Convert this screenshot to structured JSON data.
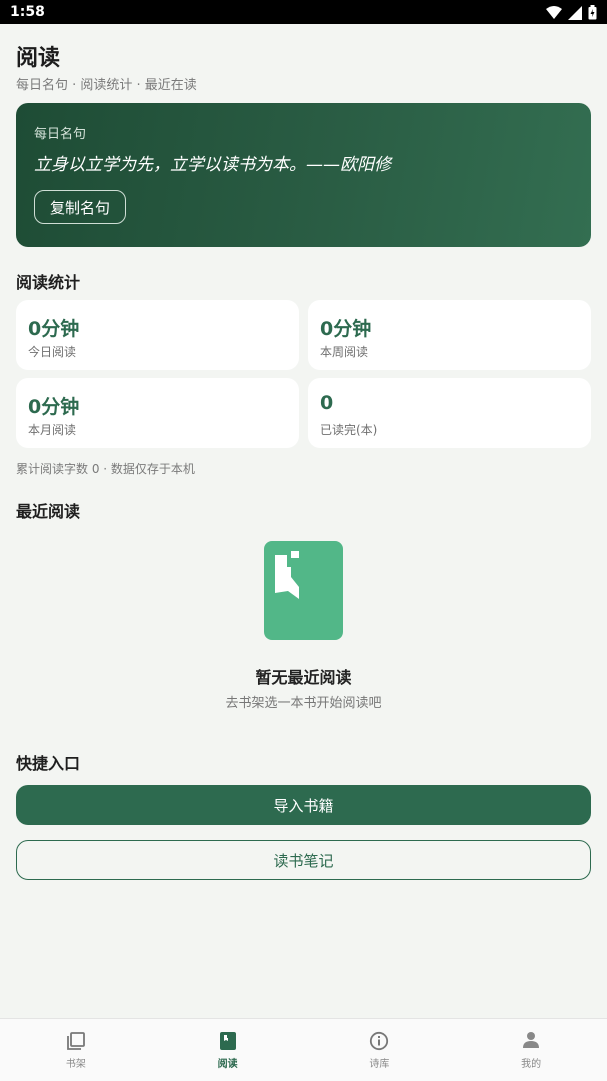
{
  "status_bar": {
    "time": "1:58"
  },
  "header": {
    "title": "阅读",
    "subtitle": "每日名句 · 阅读统计 · 最近在读"
  },
  "quote_card": {
    "label": "每日名句",
    "text": "立身以立学为先，立学以读书为本。——欧阳修",
    "copy_button": "复制名句"
  },
  "stats": {
    "title": "阅读统计",
    "cards": [
      {
        "value": "0分钟",
        "label": "今日阅读"
      },
      {
        "value": "0分钟",
        "label": "本周阅读"
      },
      {
        "value": "0分钟",
        "label": "本月阅读"
      },
      {
        "value": "0",
        "label": "已读完(本)"
      }
    ],
    "note": "累计阅读字数 0 · 数据仅存于本机"
  },
  "recent": {
    "title": "最近阅读",
    "empty_title": "暂无最近阅读",
    "empty_subtitle": "去书架选一本书开始阅读吧"
  },
  "quick": {
    "title": "快捷入口",
    "import_button": "导入书籍",
    "notes_button": "读书笔记"
  },
  "bottom_nav": {
    "items": [
      {
        "label": "书架",
        "icon": "bookshelf-icon"
      },
      {
        "label": "阅读",
        "icon": "book-icon"
      },
      {
        "label": "诗库",
        "icon": "info-icon"
      },
      {
        "label": "我的",
        "icon": "person-icon"
      }
    ],
    "active": "阅读"
  },
  "colors": {
    "accent": "#2d6a4f",
    "accent_light": "#52b788",
    "background": "#f3f5f2"
  }
}
